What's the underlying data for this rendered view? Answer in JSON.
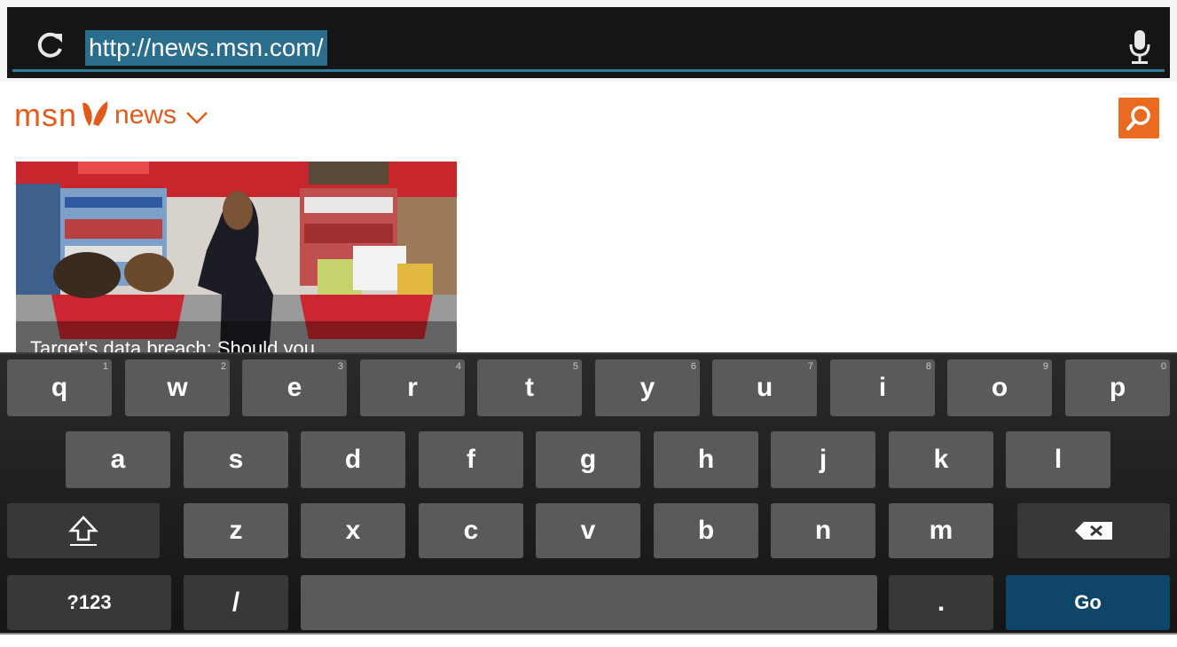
{
  "browser": {
    "url": "http://news.msn.com/"
  },
  "site": {
    "logo_brand": "msn",
    "logo_section": "news"
  },
  "article": {
    "title": "Target's data breach: Should you"
  },
  "keyboard": {
    "row1": [
      {
        "label": "q",
        "hint": "1"
      },
      {
        "label": "w",
        "hint": "2"
      },
      {
        "label": "e",
        "hint": "3"
      },
      {
        "label": "r",
        "hint": "4"
      },
      {
        "label": "t",
        "hint": "5"
      },
      {
        "label": "y",
        "hint": "6"
      },
      {
        "label": "u",
        "hint": "7"
      },
      {
        "label": "i",
        "hint": "8"
      },
      {
        "label": "o",
        "hint": "9"
      },
      {
        "label": "p",
        "hint": "0"
      }
    ],
    "row2": [
      "a",
      "s",
      "d",
      "f",
      "g",
      "h",
      "j",
      "k",
      "l"
    ],
    "row3": [
      "z",
      "x",
      "c",
      "v",
      "b",
      "n",
      "m"
    ],
    "symbols_label": "?123",
    "slash_label": "/",
    "period_label": ".",
    "go_label": "Go"
  },
  "colors": {
    "accent": "#2b7e9e",
    "brand": "#e25b1a",
    "go_key": "#0f4668"
  }
}
